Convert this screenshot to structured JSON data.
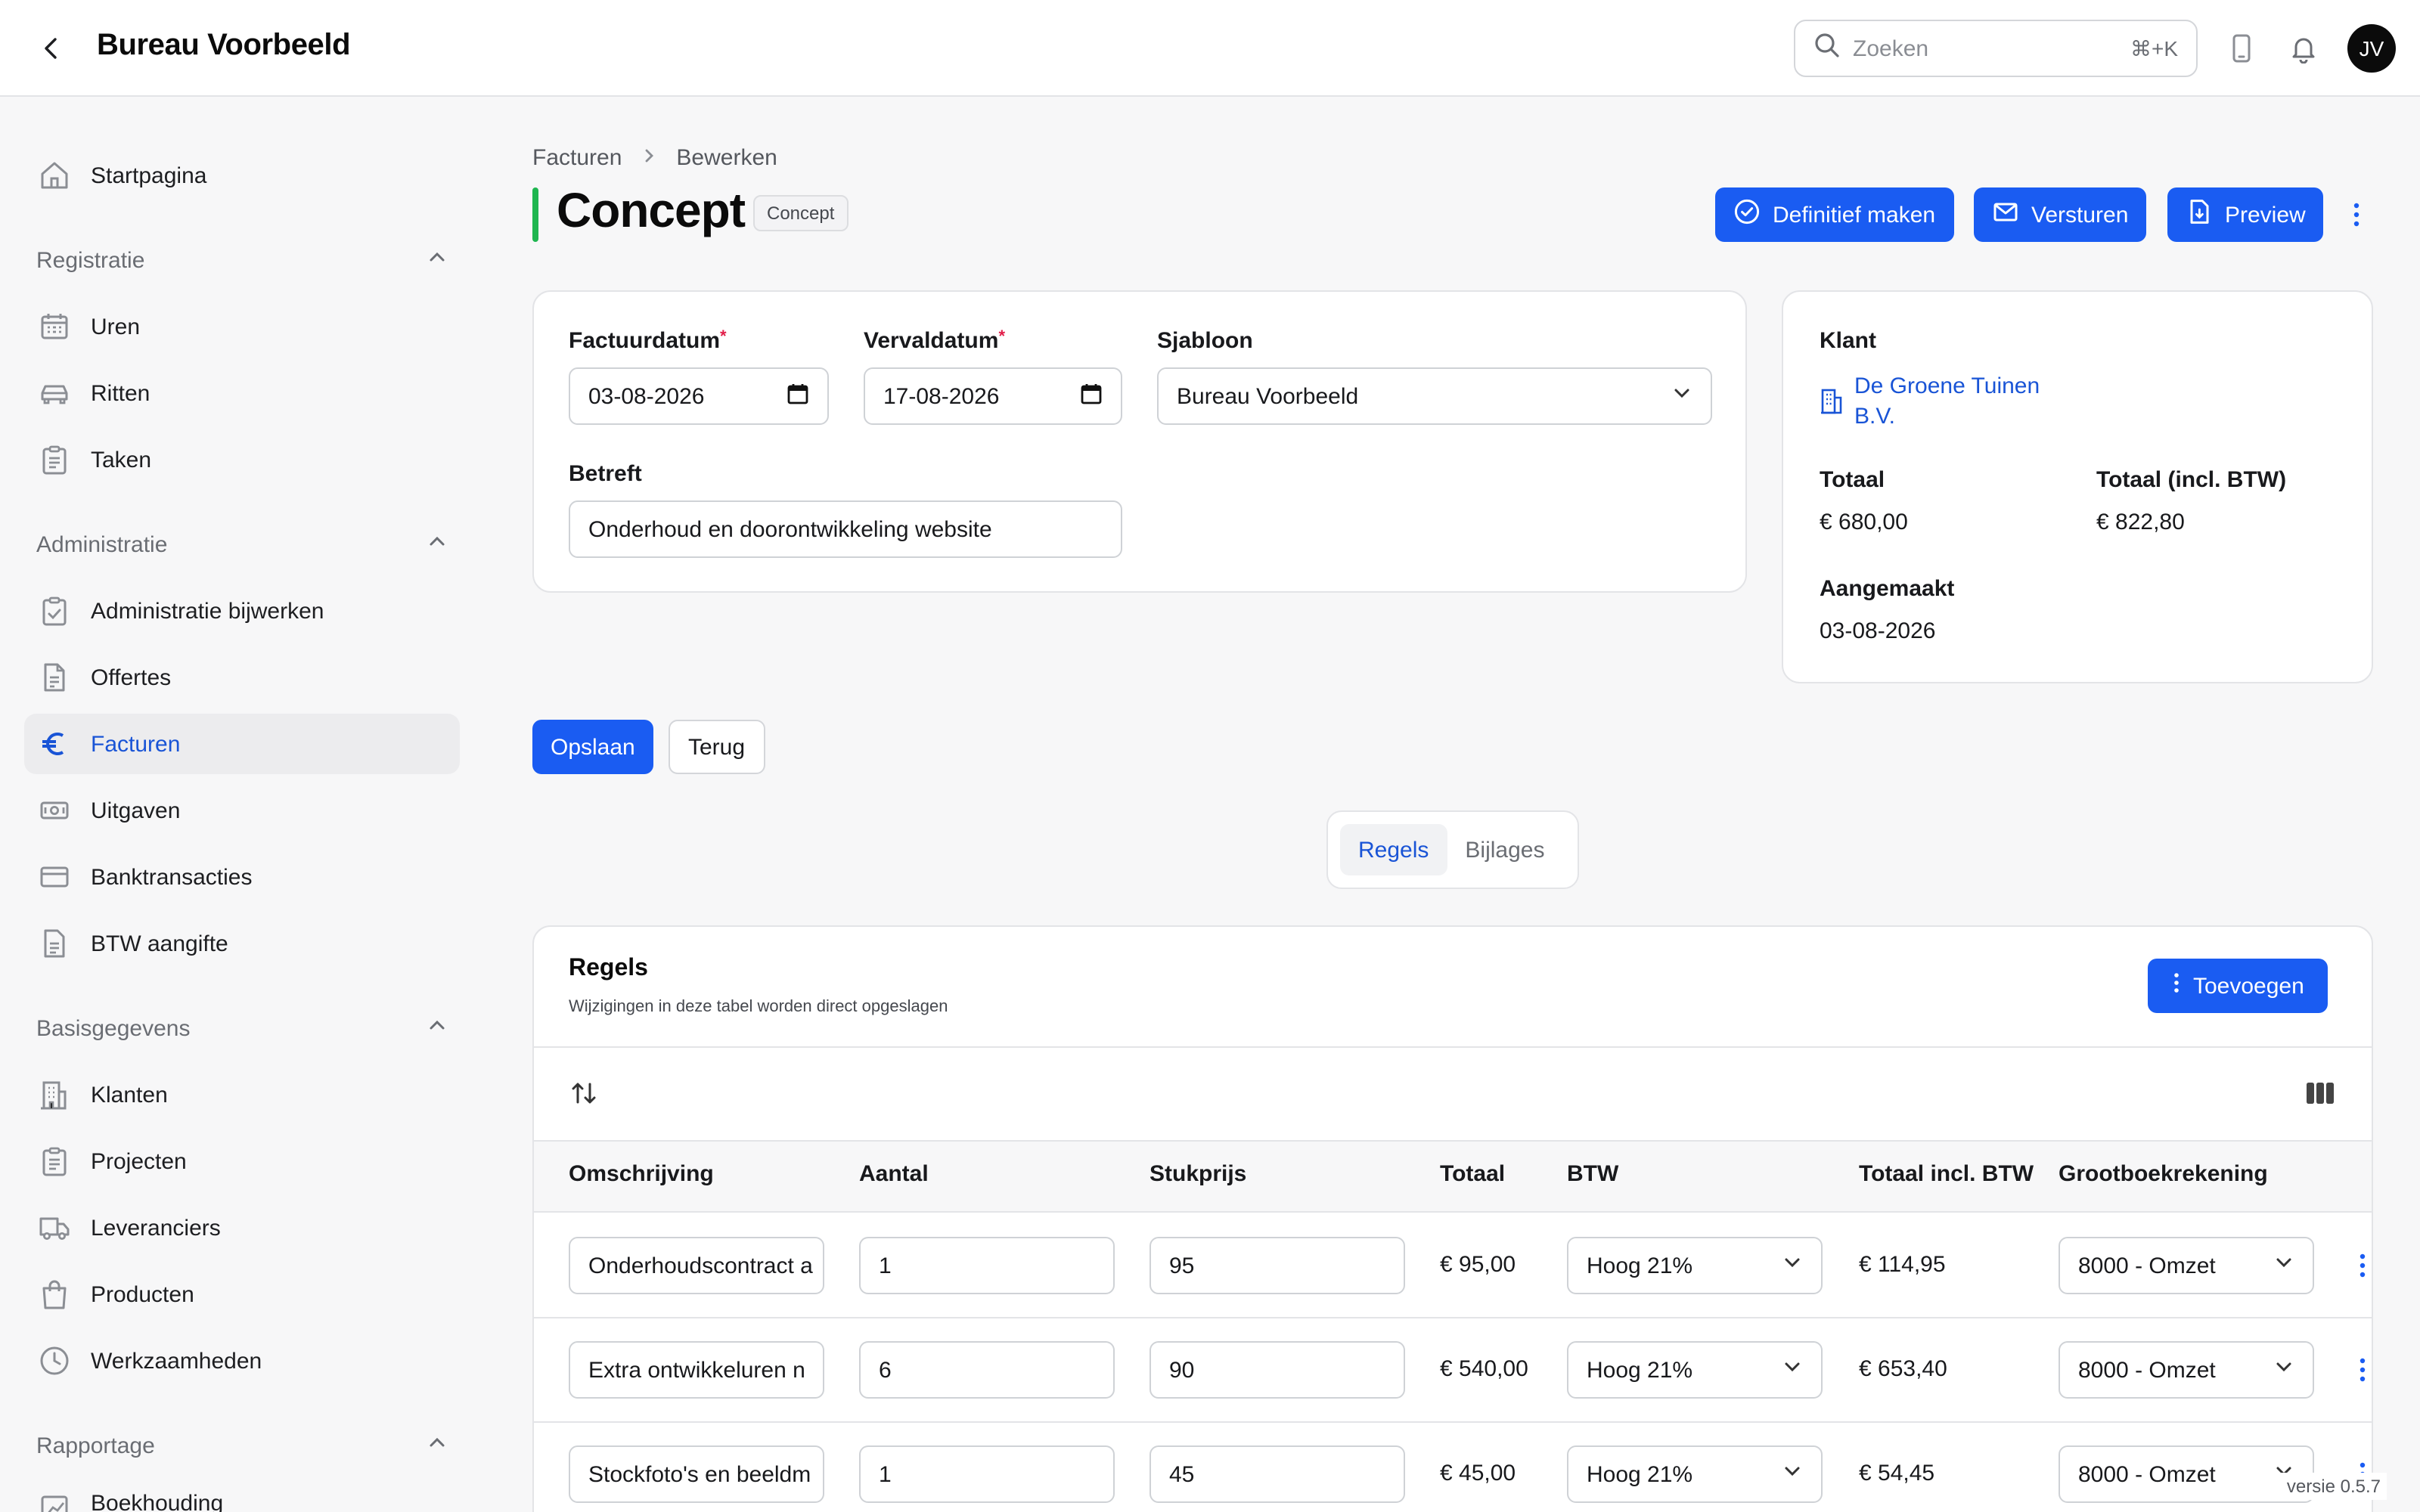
{
  "header": {
    "title": "Bureau Voorbeeld",
    "search_placeholder": "Zoeken",
    "search_shortcut": "⌘+K",
    "avatar_initials": "JV"
  },
  "sidebar": {
    "home": "Startpagina",
    "sections": [
      {
        "title": "Registratie",
        "items": [
          "Uren",
          "Ritten",
          "Taken"
        ]
      },
      {
        "title": "Administratie",
        "items": [
          "Administratie bijwerken",
          "Offertes",
          "Facturen",
          "Uitgaven",
          "Banktransacties",
          "BTW aangifte"
        ]
      },
      {
        "title": "Basisgegevens",
        "items": [
          "Klanten",
          "Projecten",
          "Leveranciers",
          "Producten",
          "Werkzaamheden"
        ]
      },
      {
        "title": "Rapportage",
        "items": [
          "Boekhouding"
        ]
      }
    ],
    "active_item": "Facturen"
  },
  "breadcrumb": {
    "parent": "Facturen",
    "current": "Bewerken"
  },
  "page": {
    "title": "Concept",
    "badge": "Concept",
    "actions": {
      "finalize": "Definitief maken",
      "send": "Versturen",
      "preview": "Preview"
    }
  },
  "form": {
    "invoice_date_label": "Factuurdatum",
    "invoice_date": "03-08-2026",
    "due_date_label": "Vervaldatum",
    "due_date": "17-08-2026",
    "template_label": "Sjabloon",
    "template": "Bureau Voorbeeld",
    "subject_label": "Betreft",
    "subject": "Onderhoud en doorontwikkeling website",
    "required_mark": "*"
  },
  "summary": {
    "client_label": "Klant",
    "client_line1": "De Groene Tuinen",
    "client_line2": "B.V.",
    "total_label": "Totaal",
    "total": "€ 680,00",
    "total_incl_label": "Totaal (incl. BTW)",
    "total_incl": "€ 822,80",
    "created_label": "Aangemaakt",
    "created": "03-08-2026"
  },
  "buttons": {
    "save": "Opslaan",
    "back": "Terug"
  },
  "tabs": [
    "Regels",
    "Bijlages"
  ],
  "rules": {
    "title": "Regels",
    "subtitle": "Wijzigingen in deze tabel worden direct opgeslagen",
    "add_label": "Toevoegen",
    "columns": [
      "Omschrijving",
      "Aantal",
      "Stukprijs",
      "Totaal",
      "BTW",
      "Totaal incl. BTW",
      "Grootboekrekening"
    ],
    "rows": [
      {
        "desc": "Onderhoudscontract a",
        "qty": "1",
        "price": "95",
        "total": "€ 95,00",
        "vat": "Hoog 21%",
        "total_incl": "€ 114,95",
        "ledger": "8000 - Omzet"
      },
      {
        "desc": "Extra ontwikkeluren n",
        "qty": "6",
        "price": "90",
        "total": "€ 540,00",
        "vat": "Hoog 21%",
        "total_incl": "€ 653,40",
        "ledger": "8000 - Omzet"
      },
      {
        "desc": "Stockfoto's en beeldm",
        "qty": "1",
        "price": "45",
        "total": "€ 45,00",
        "vat": "Hoog 21%",
        "total_incl": "€ 54,45",
        "ledger": "8000 - Omzet"
      }
    ]
  },
  "version": "versie 0.5.7",
  "colors": {
    "primary": "#1a5cf2",
    "accent_bar": "#1fb650",
    "link": "#1954d6"
  }
}
